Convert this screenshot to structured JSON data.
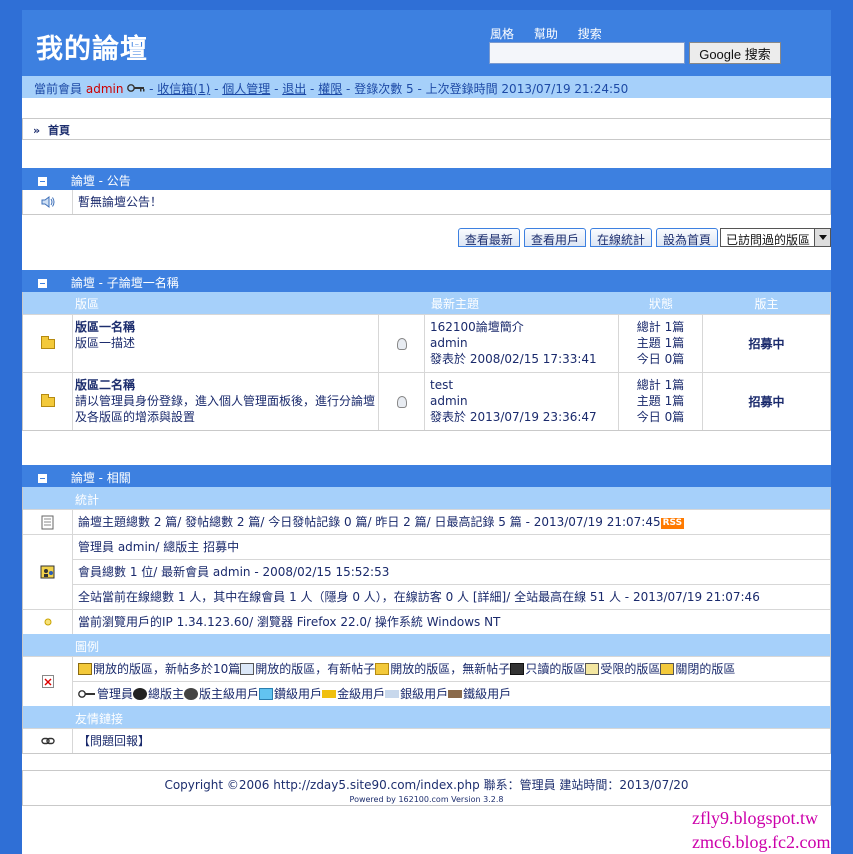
{
  "header": {
    "site_title": "我的論壇",
    "links": [
      "風格",
      "幫助",
      "搜索"
    ],
    "search_button": "Google 搜索",
    "search_value": ""
  },
  "member_bar": {
    "prefix": "當前會員",
    "username": "admin",
    "inbox": "收信箱(1)",
    "profile": "個人管理",
    "logout": "退出",
    "perms": "權限",
    "login_count": "登錄次數 5",
    "last_login": "上次登錄時間 2013/07/19 21:24:50",
    "sep": " - "
  },
  "nav": {
    "home": "首頁"
  },
  "announce": {
    "title": "論壇 - 公告",
    "text": "暫無論壇公告！"
  },
  "toolbar": {
    "buttons": [
      "查看最新",
      "查看用戶",
      "在線統計",
      "設為首頁"
    ],
    "select_value": "已訪問過的版區"
  },
  "forums": {
    "title": "論壇 - 子論壇一名稱",
    "columns": [
      "版區",
      "最新主題",
      "狀態",
      "版主"
    ],
    "rows": [
      {
        "name": "版區一名稱",
        "desc": "版區一描述",
        "latest_title": "162100論壇簡介",
        "latest_user": "admin",
        "latest_time": "發表於 2008/02/15 17:33:41",
        "stat_total": "總計 1篇",
        "stat_topics": "主題 1篇",
        "stat_today": "今日 0篇",
        "moderator": "招募中"
      },
      {
        "name": "版區二名稱",
        "desc": "請以管理員身份登錄，進入個人管理面板後，進行分論壇及各版區的增添與設置",
        "latest_title": "test",
        "latest_user": "admin",
        "latest_time": "發表於 2013/07/19 23:36:47",
        "stat_total": "總計 1篇",
        "stat_topics": "主題 1篇",
        "stat_today": "今日 0篇",
        "moderator": "招募中"
      }
    ]
  },
  "related": {
    "title": "論壇 - 相關",
    "stats_head": "統計",
    "stats_line1": "論壇主題總數 2 篇/ 發帖總數 2 篇/ 今日發帖記錄 0 篇/ 昨日 2 篇/ 日最高記錄 5 篇 - 2013/07/19 21:07:45",
    "rss": "RSS",
    "admin_line": "管理員 admin/ 總版主 招募中",
    "member_line": "會員總數 1 位/ 最新會員 admin - 2008/02/15 15:52:53",
    "online_line": "全站當前在線總數 1 人，其中在線會員 1 人（隱身 0 人），在線訪客 0 人 [詳細]/ 全站最高在線 51 人 - 2013/07/19 21:07:46",
    "ip_line": "當前瀏覽用戶的IP 1.34.123.60/ 瀏覽器 Firefox 22.0/ 操作系統 Windows NT",
    "legend_head": "圖例",
    "legend_forums": [
      "開放的版區，新帖多於10篇",
      "開放的版區，有新帖子",
      "開放的版區，無新帖子",
      "只讀的版區",
      "受限的版區",
      "關閉的版區"
    ],
    "legend_users": [
      "管理員",
      "總版主",
      "版主級用戶",
      "鑽級用戶",
      "金級用戶",
      "銀級用戶",
      "鐵級用戶"
    ],
    "links_head": "友情鏈接",
    "links_text": "【問題回報】"
  },
  "footer": {
    "copyright": "Copyright ©2006 http://zday5.site90.com/index.php 聯系：管理員 建站時間：2013/07/20",
    "powered": "Powered by 162100.com Version 3.2.8"
  },
  "watermark": {
    "line1": "zfly9.blogspot.tw",
    "line2": "zmc6.blog.fc2.com"
  },
  "colors": {
    "frame": "#2f6fd6",
    "header": "#3d80e0",
    "subbar": "#a6d0fa",
    "username": "#cc0000",
    "watermark": "#cc00aa"
  }
}
